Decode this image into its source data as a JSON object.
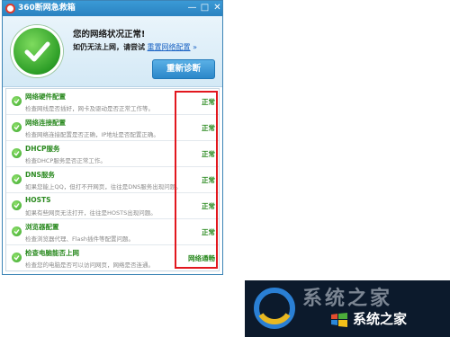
{
  "window": {
    "title": "360断网急救箱",
    "min_symbol": "—",
    "max_symbol": "□",
    "close_symbol": "✕"
  },
  "header": {
    "status_title": "您的网络状况正常!",
    "retry_prefix": "如仍无法上网，请尝试",
    "reset_link": "重置网络配置",
    "reset_arrow": "»",
    "rediagnose_label": "重新诊断"
  },
  "checks": [
    {
      "name": "网络硬件配置",
      "desc": "检查网线是否插好，网卡及驱动是否正常工作等。",
      "result": "正常"
    },
    {
      "name": "网络连接配置",
      "desc": "检查网络连接配置是否正确，IP地址是否配置正确。",
      "result": "正常"
    },
    {
      "name": "DHCP服务",
      "desc": "检查DHCP服务是否正常工作。",
      "result": "正常"
    },
    {
      "name": "DNS服务",
      "desc": "如果您能上QQ，但打不开网页，往往是DNS服务出现问题。",
      "result": "正常"
    },
    {
      "name": "HOSTS",
      "desc": "如果有些网页无法打开，往往是HOSTS出现问题。",
      "result": "正常"
    },
    {
      "name": "浏览器配置",
      "desc": "检查浏览器代理、Flash插件等配置问题。",
      "result": "正常"
    },
    {
      "name": "检查电脑能否上网",
      "desc": "检查您的电脑是否可以访问网页，网络是否连通。",
      "result": "网络通畅"
    }
  ],
  "watermark": {
    "big_text": "系统之家",
    "text": "系统之家"
  },
  "colors": {
    "accent": "#2a82c0",
    "ok_green": "#2b8a20",
    "highlight_red": "#e2171e"
  }
}
